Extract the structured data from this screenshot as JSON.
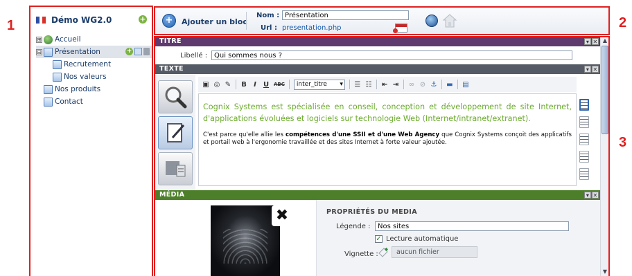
{
  "callouts": {
    "one": "1",
    "two": "2",
    "three": "3"
  },
  "colors": {
    "callout_red": "#e02020",
    "titre_bar": "#5e3a6f",
    "texte_bar": "#555b66",
    "media_bar": "#4d7f2a",
    "lead_green": "#6bab2d",
    "link_blue": "#1a5aa8"
  },
  "sidebar": {
    "flag_icon": "french-flag-icon",
    "title": "Démo WG2.0",
    "add_icon": "plus-icon",
    "tree": [
      {
        "label": "Accueil",
        "icon": "globe-icon",
        "expander": "⊞"
      },
      {
        "label": "Présentation",
        "icon": "page-icon",
        "expander": "⊟",
        "selected": true
      },
      {
        "label": "Recrutement",
        "icon": "page-icon"
      },
      {
        "label": "Nos valeurs",
        "icon": "page-icon"
      },
      {
        "label": "Nos produits",
        "icon": "page-icon"
      },
      {
        "label": "Contact",
        "icon": "page-icon"
      }
    ]
  },
  "toolbar": {
    "add_icon": "add-circle-icon",
    "add_symbol": "+",
    "add_block_label": "Ajouter un bloc",
    "nom_label": "Nom :",
    "nom_value": "Présentation",
    "url_label": "Url :",
    "url_value": "presentation.php",
    "calendar_icon": "calendar-icon",
    "world_icon": "globe-icon",
    "home_icon": "home-icon"
  },
  "titre": {
    "header": "TITRE",
    "libelle_label": "Libellé :",
    "libelle_value": "Qui sommes nous ?",
    "ctrl_min": "▾",
    "ctrl_close": "✕"
  },
  "texte": {
    "header": "TEXTE",
    "ctrl_min": "▾",
    "ctrl_close": "✕",
    "mode_icons": [
      "zoom-icon",
      "edit-icon",
      "image-icon"
    ],
    "editor_toolbar": {
      "bold": "B",
      "italic": "I",
      "underline": "U",
      "strike": "ABC",
      "style_select": "inter_titre"
    },
    "content": {
      "lead": "Cognix Systems est spécialisée en conseil, conception et développement de site Internet, d'applications évoluées et logiciels sur technologie Web (Internet/intranet/extranet).",
      "body_1": "C'est parce qu'elle allie les ",
      "body_b1": "compétences d'une SSII et d'une Web Agency",
      "body_2": " que Cognix Systems conçoit des applicatifs et portail web à l'ergonomie travaillée et des sites Internet à forte valeur ajoutée."
    },
    "align_icons": [
      "align-left-icon",
      "align-justify-icon",
      "align-center-icon",
      "align-right-icon",
      "align-full-icon"
    ]
  },
  "media": {
    "header": "MÉDIA",
    "ctrl_min": "▾",
    "ctrl_close": "✕",
    "close_symbol": "✖",
    "props_title": "PROPRIÉTÉS DU MEDIA",
    "legend_label": "Légende :",
    "legend_value": "Nos sites",
    "auto_label": "Lecture automatique",
    "auto_checked": "✓",
    "vignette_label": "Vignette :",
    "vignette_value": "aucun fichier"
  },
  "scrollbar": {
    "up": "▲",
    "down": "▼"
  }
}
